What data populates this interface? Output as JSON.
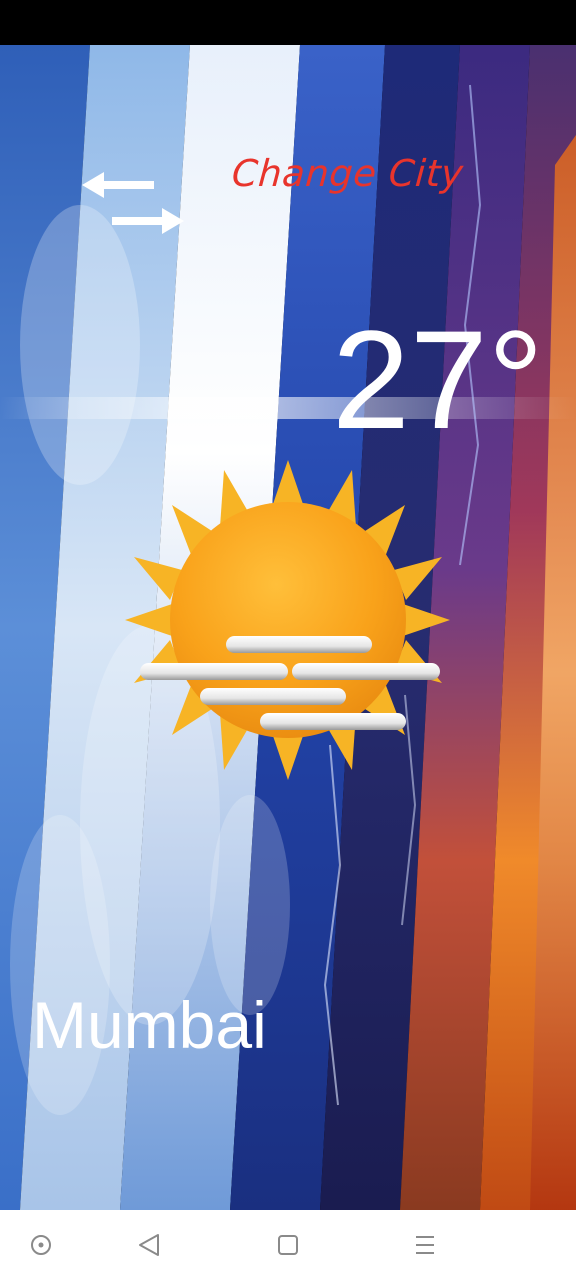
{
  "header": {
    "change_city_label": "Change City"
  },
  "weather": {
    "temperature": "27°",
    "condition_icon": "sun-with-fog-icon",
    "city": "Mumbai"
  },
  "nav": {
    "items": [
      "screen-assistant-icon",
      "back-icon",
      "home-icon",
      "menu-icon"
    ]
  },
  "colors": {
    "accent": "#e8342c",
    "text": "#ffffff",
    "status_bar": "#000000",
    "nav_bar": "#ffffff"
  }
}
